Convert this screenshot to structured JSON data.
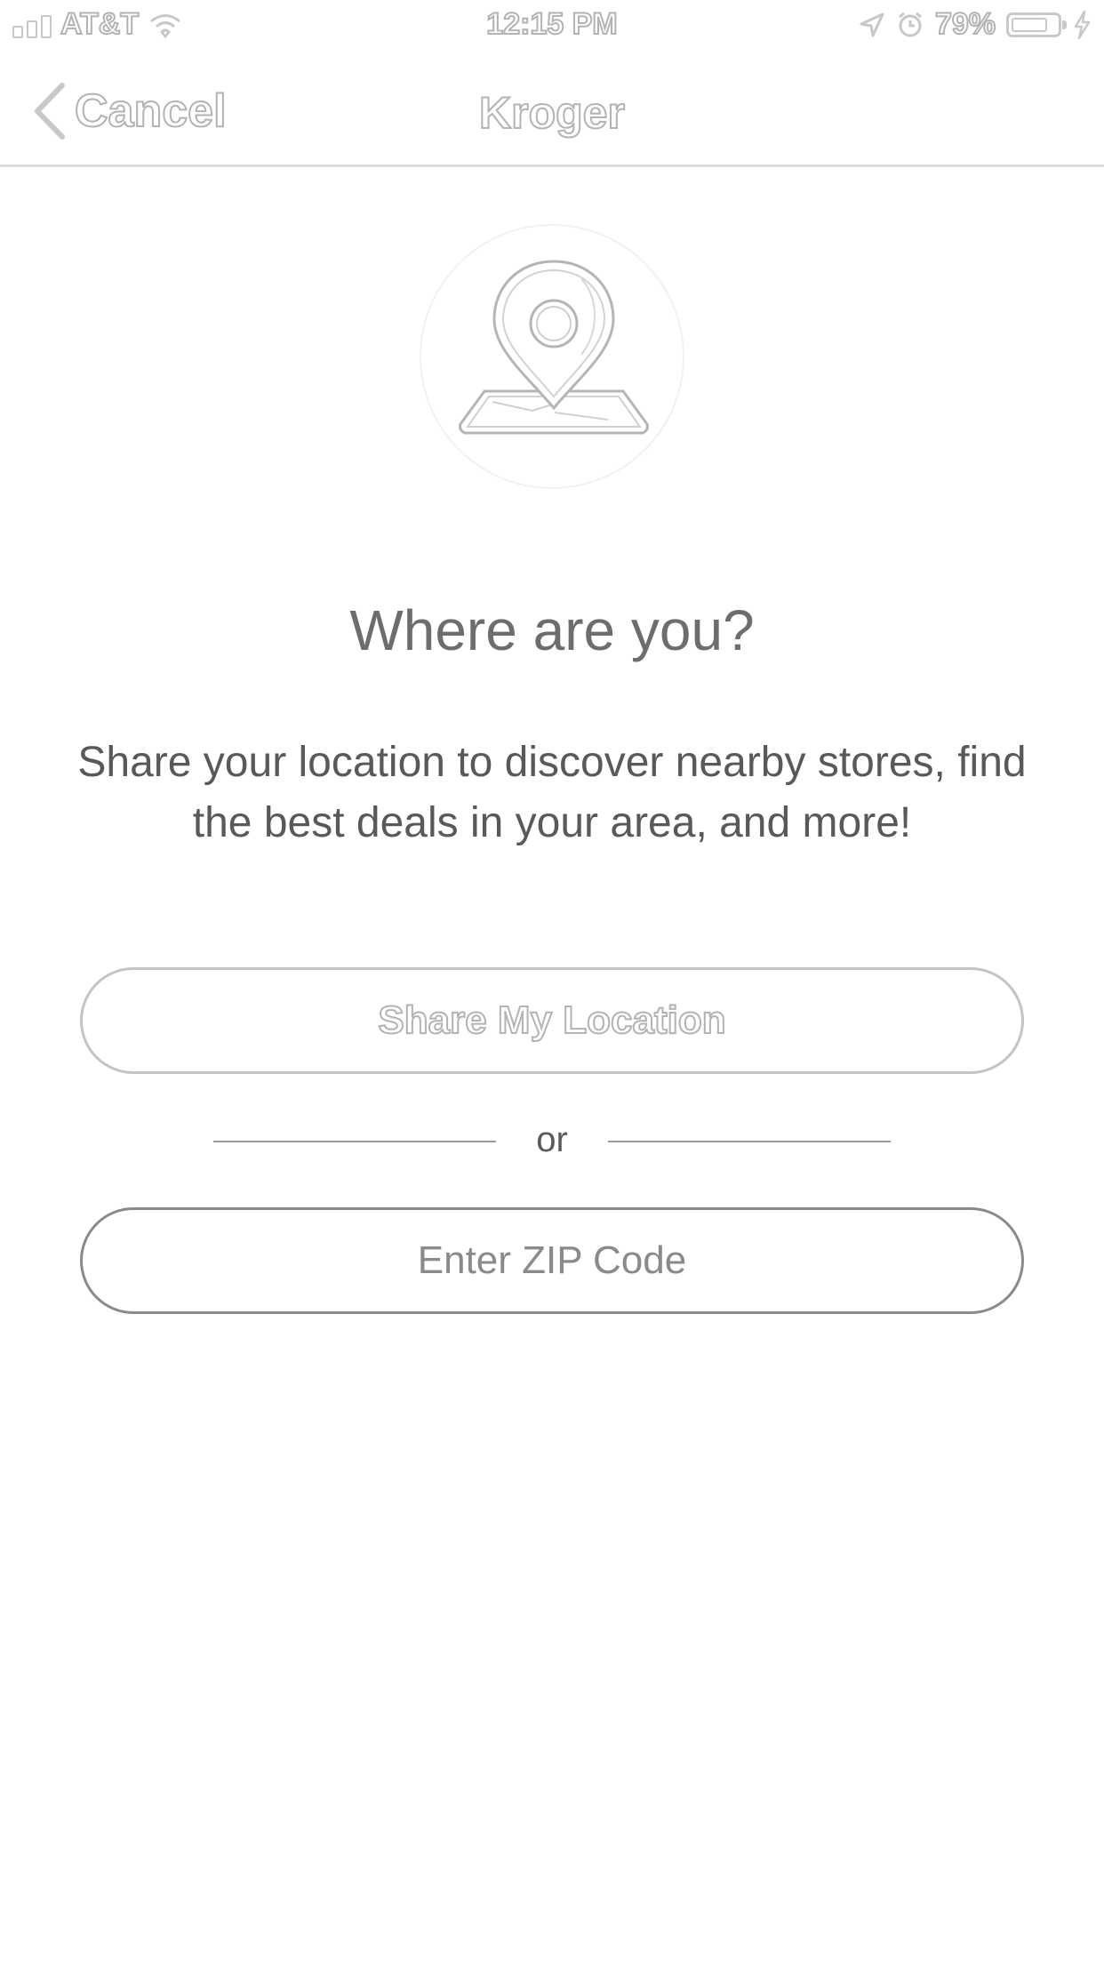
{
  "status_bar": {
    "carrier": "AT&T",
    "time": "12:15 PM",
    "battery": "79%",
    "battery_level": 0.79
  },
  "nav": {
    "back_label": "Cancel",
    "title": "Kroger"
  },
  "prompt": {
    "icon": "map-pin-icon",
    "heading": "Where are you?",
    "description": "Share your location to discover nearby stores, find the best deals in your area, and more!"
  },
  "actions": {
    "share_label": "Share My Location",
    "divider_label": "or",
    "zip_label": "Enter ZIP Code"
  }
}
